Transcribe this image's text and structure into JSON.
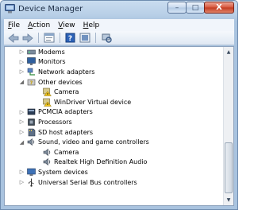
{
  "window": {
    "title": "Device Manager"
  },
  "caption_buttons": {
    "minimize": "–",
    "maximize": "□",
    "close": "X"
  },
  "menu": [
    {
      "label": "File",
      "key": "F",
      "rest": "ile"
    },
    {
      "label": "Action",
      "key": "A",
      "rest": "ction"
    },
    {
      "label": "View",
      "key": "V",
      "rest": "iew"
    },
    {
      "label": "Help",
      "key": "H",
      "rest": "elp"
    }
  ],
  "toolbar": [
    "back-icon",
    "forward-icon",
    "properties-icon",
    "help-icon",
    "update-icon",
    "scan-icon"
  ],
  "tree": [
    {
      "label": "Modems",
      "icon": "modem-icon",
      "expander": "collapsed"
    },
    {
      "label": "Monitors",
      "icon": "monitor-icon",
      "expander": "collapsed"
    },
    {
      "label": "Network adapters",
      "icon": "network-icon",
      "expander": "collapsed"
    },
    {
      "label": "Other devices",
      "icon": "unknown-device-icon",
      "expander": "expanded"
    },
    {
      "label": "Camera",
      "icon": "warning-device-icon",
      "child": true
    },
    {
      "label": "WinDriver Virtual device",
      "icon": "warning-device-icon",
      "child": true
    },
    {
      "label": "PCMCIA adapters",
      "icon": "pcmcia-icon",
      "expander": "collapsed"
    },
    {
      "label": "Processors",
      "icon": "processor-icon",
      "expander": "collapsed"
    },
    {
      "label": "SD host adapters",
      "icon": "sd-card-icon",
      "expander": "collapsed"
    },
    {
      "label": "Sound, video and game controllers",
      "icon": "speaker-icon",
      "expander": "expanded"
    },
    {
      "label": "Camera",
      "icon": "speaker-icon",
      "child": true
    },
    {
      "label": "Realtek High Definition Audio",
      "icon": "speaker-icon",
      "child": true
    },
    {
      "label": "System devices",
      "icon": "system-icon",
      "expander": "collapsed"
    },
    {
      "label": "Universal Serial Bus controllers",
      "icon": "usb-icon",
      "expander": "collapsed"
    }
  ]
}
